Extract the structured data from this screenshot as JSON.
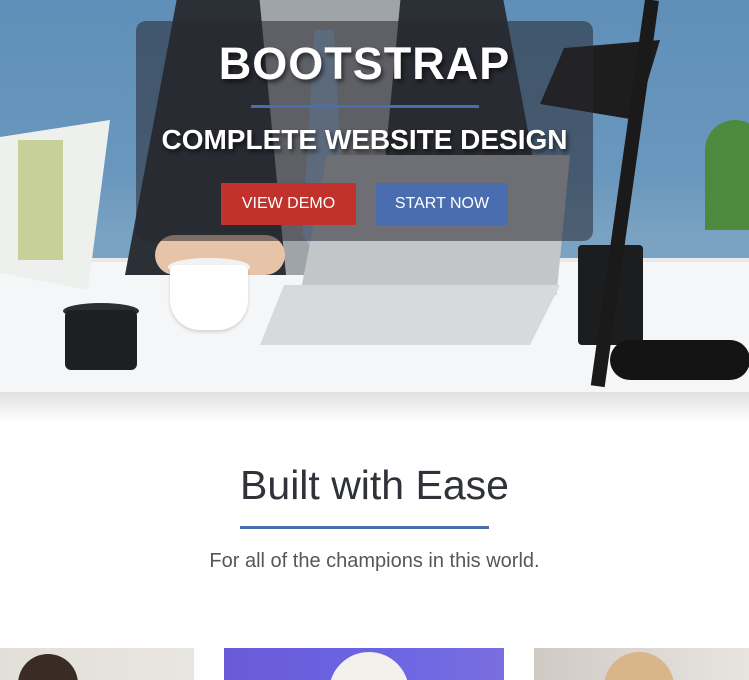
{
  "hero": {
    "title": "BOOTSTRAP",
    "subtitle": "COMPLETE WEBSITE DESIGN",
    "buttons": {
      "view_demo": "VIEW DEMO",
      "start_now": "START NOW"
    }
  },
  "section": {
    "title": "Built with Ease",
    "subtitle": "For all of the champions in this world."
  },
  "colors": {
    "accent_blue": "#4a6db0",
    "accent_red": "#c0322b",
    "text_dark": "#2f3238"
  }
}
